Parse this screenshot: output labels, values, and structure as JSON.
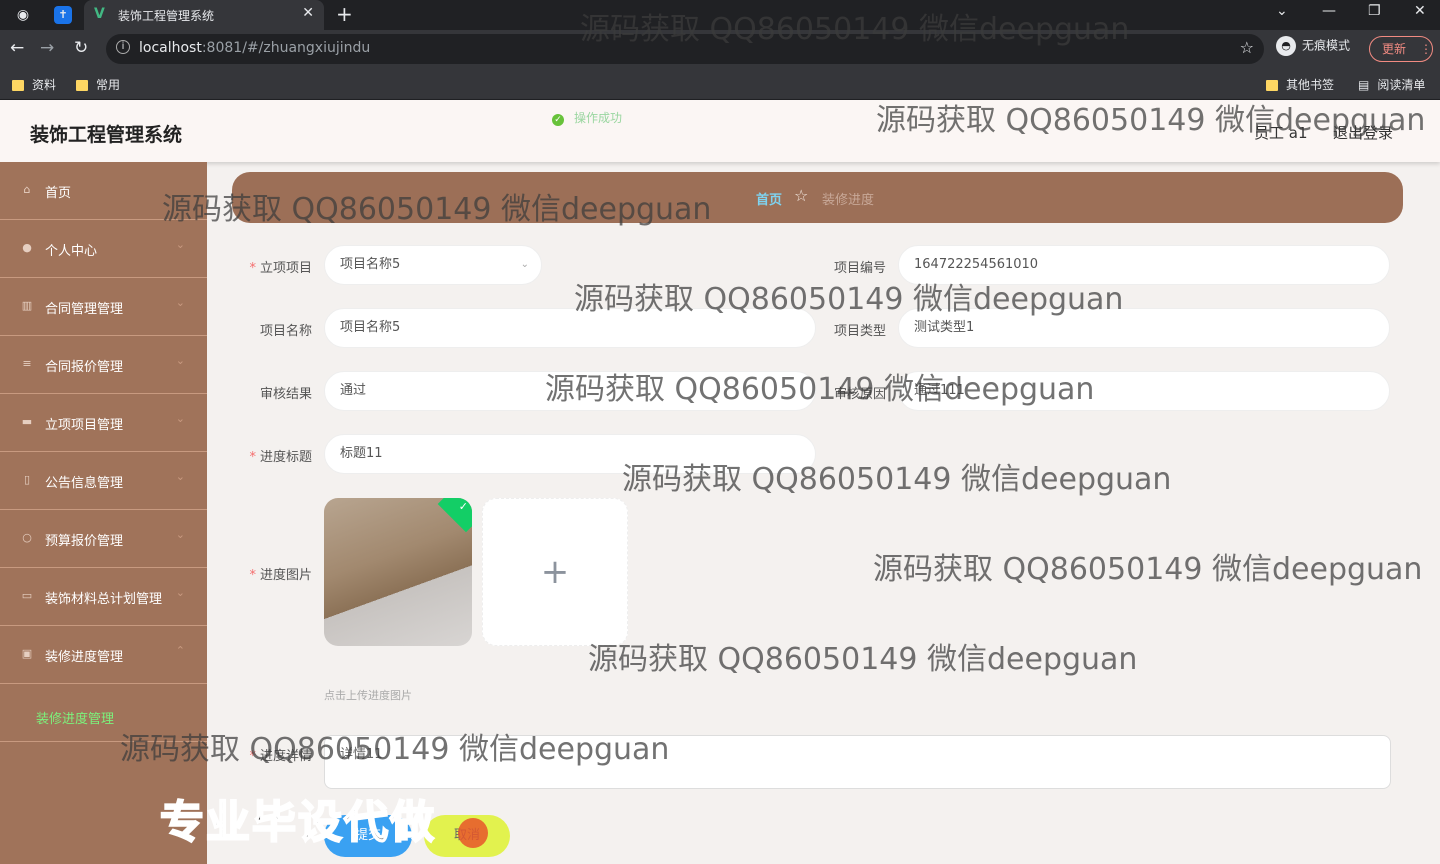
{
  "browser": {
    "tab_title": "装饰工程管理系统",
    "url_host": "localhost",
    "url_rest": ":8081/#/zhuangxiujindu",
    "incognito_label": "无痕模式",
    "update_label": "更新",
    "bookmarks": [
      "资料",
      "常用"
    ],
    "bookmarks_right": [
      "其他书签",
      "阅读清单"
    ]
  },
  "header": {
    "brand": "装饰工程管理系统",
    "toast": "操作成功",
    "user": "员工 a1",
    "logout": "退出登录"
  },
  "sidebar": {
    "items": [
      {
        "label": "首页",
        "icon": "home-icon"
      },
      {
        "label": "个人中心",
        "icon": "user-icon"
      },
      {
        "label": "合同管理管理",
        "icon": "contract-icon"
      },
      {
        "label": "合同报价管理",
        "icon": "list-icon"
      },
      {
        "label": "立项项目管理",
        "icon": "project-icon"
      },
      {
        "label": "公告信息管理",
        "icon": "notice-icon"
      },
      {
        "label": "预算报价管理",
        "icon": "budget-icon"
      },
      {
        "label": "装饰材料总计划管理",
        "icon": "material-icon"
      },
      {
        "label": "装修进度管理",
        "icon": "progress-icon"
      }
    ],
    "sub_active": "装修进度管理"
  },
  "breadcrumb": {
    "home": "首页",
    "current": "装修进度"
  },
  "form": {
    "project_label": "立项项目",
    "project_value": "项目名称5",
    "code_label": "项目编号",
    "code_value": "164722254561010",
    "name_label": "项目名称",
    "name_value": "项目名称5",
    "type_label": "项目类型",
    "type_value": "测试类型1",
    "audit_label": "审核结果",
    "audit_value": "通过",
    "reason_label": "审核原因",
    "reason_value": "通过111",
    "title_label": "进度标题",
    "title_value": "标题11",
    "image_label": "进度图片",
    "upload_hint": "点击上传进度图片",
    "detail_label": "进度详情",
    "detail_value": "详情11",
    "submit": "提交",
    "cancel": "取消"
  },
  "watermark": "源码获取 QQ86050149 微信deepguan",
  "promo": "专业毕设代做"
}
